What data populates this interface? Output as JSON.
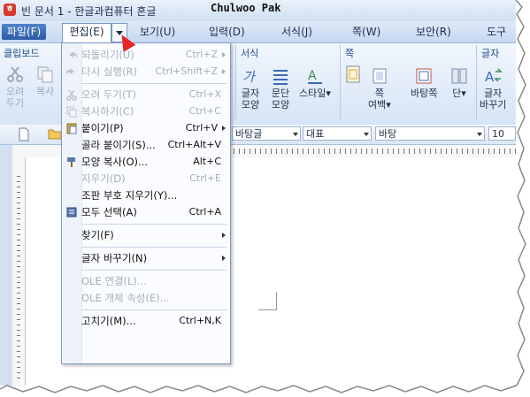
{
  "window": {
    "title": "빈 문서 1 - 한글과컴퓨터 흔글",
    "app_icon_glyph": "ㅎ",
    "watermark": "Chulwoo Pak"
  },
  "menubar": {
    "items": [
      "파일(F)",
      "편집(E)",
      "보기(U)",
      "입력(D)",
      "서식(J)",
      "쪽(W)",
      "보안(R)",
      "도구"
    ]
  },
  "ribbon": {
    "groups": {
      "clipboard": "클립보드",
      "format": "서식",
      "page": "쪽",
      "font": "글자"
    },
    "buttons": {
      "cut": [
        "오려",
        "두기"
      ],
      "copy": "복사",
      "char_shape": [
        "글자",
        "모양"
      ],
      "para_shape": [
        "문단",
        "모양"
      ],
      "style": "스타일",
      "page_margin": [
        "쪽",
        "여백"
      ],
      "page_border": "바탕쪽",
      "columns": "단",
      "char_replace": [
        "글자",
        "바꾸기"
      ]
    }
  },
  "toolbar": {
    "style_combo": "바탕글",
    "lang_combo": "대표",
    "font_combo": "바탕",
    "size_combo": "10"
  },
  "edit_menu": {
    "items": [
      {
        "label": "되돌리기(U)",
        "shortcut": "Ctrl+Z",
        "enabled": false,
        "submenu": true,
        "icon": "undo-icon"
      },
      {
        "label": "다시 실행(R)",
        "shortcut": "Ctrl+Shift+Z",
        "enabled": false,
        "submenu": true,
        "icon": "redo-icon"
      },
      {
        "sep": true
      },
      {
        "label": "오려 두기(T)",
        "shortcut": "Ctrl+X",
        "enabled": false,
        "icon": "scissors-icon"
      },
      {
        "label": "복사하기(C)",
        "shortcut": "Ctrl+C",
        "enabled": false,
        "icon": "copy-icon"
      },
      {
        "label": "붙이기(P)",
        "shortcut": "Ctrl+V",
        "enabled": true,
        "submenu": true,
        "icon": "clipboard-icon"
      },
      {
        "label": "골라 붙이기(S)...",
        "shortcut": "Ctrl+Alt+V",
        "enabled": true
      },
      {
        "label": "모양 복사(O)...",
        "shortcut": "Alt+C",
        "enabled": true,
        "icon": "format-painter-icon"
      },
      {
        "label": "지우기(D)",
        "shortcut": "Ctrl+E",
        "enabled": false
      },
      {
        "label": "조판 부호 지우기(Y)...",
        "shortcut": "",
        "enabled": true
      },
      {
        "label": "모두 선택(A)",
        "shortcut": "Ctrl+A",
        "enabled": true,
        "icon": "select-all-icon"
      },
      {
        "sep": true
      },
      {
        "label": "찾기(F)",
        "shortcut": "",
        "enabled": true,
        "submenu": true
      },
      {
        "sep": true
      },
      {
        "label": "글자 바꾸기(N)",
        "shortcut": "",
        "enabled": true,
        "submenu": true
      },
      {
        "sep": true
      },
      {
        "label": "OLE 연결(L)...",
        "shortcut": "",
        "enabled": false
      },
      {
        "label": "OLE 개체 속성(E)...",
        "shortcut": "",
        "enabled": false
      },
      {
        "sep": true
      },
      {
        "label": "고치기(M)...",
        "shortcut": "Ctrl+N,K",
        "enabled": true
      }
    ]
  },
  "colors": {
    "accent": "#2a5aa5",
    "menu_disabled": "#a3aebc",
    "cursor": "#e52525"
  }
}
